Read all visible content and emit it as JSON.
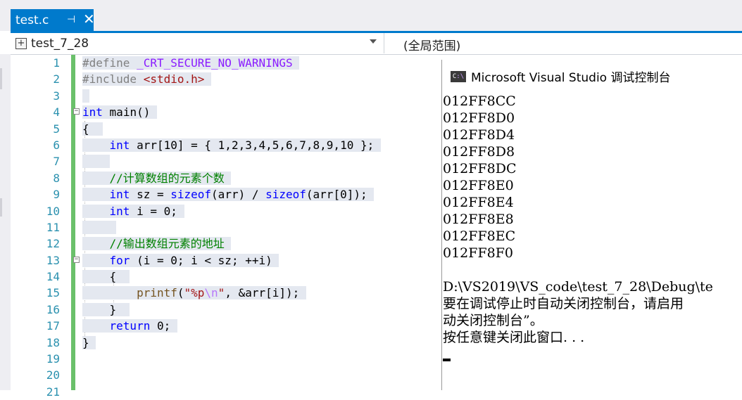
{
  "tab": {
    "title": "test.c",
    "pin_glyph": "⊣",
    "close_glyph": "✕"
  },
  "navbar": {
    "scope_left": "test_7_28",
    "scope_right": "(全局范围)"
  },
  "editor": {
    "line_numbers": [
      "1",
      "2",
      "3",
      "4",
      "5",
      "6",
      "7",
      "8",
      "9",
      "10",
      "11",
      "12",
      "13",
      "14",
      "15",
      "16",
      "17",
      "18",
      "19",
      "20",
      "21"
    ]
  },
  "console": {
    "title": "Microsoft Visual Studio 调试控制台",
    "output_lines": [
      "012FF8CC",
      "012FF8D0",
      "012FF8D4",
      "012FF8D8",
      "012FF8DC",
      "012FF8E0",
      "012FF8E4",
      "012FF8E8",
      "012FF8EC",
      "012FF8F0",
      "",
      "D:\\VS2019\\VS_code\\test_7_28\\Debug\\te",
      "要在调试停止时自动关闭控制台，请启用",
      "动关闭控制台”。",
      "按任意键关闭此窗口. . ."
    ]
  },
  "code": {
    "l1_kw": "#define",
    "l1_macro": "_CRT_SECURE_NO_WARNINGS",
    "l2_kw": "#include",
    "l2_hdr": "<stdio.h>",
    "l4_type": "int",
    "l4_rest": "main()",
    "l5": "{",
    "l6_type": "int",
    "l6_rest": "arr[10] = { 1,2,3,4,5,6,7,8,9,10 };",
    "l8_comment": "//计算数组的元素个数",
    "l9_type": "int",
    "l9_a": "sz = ",
    "l9_sizeof1": "sizeof",
    "l9_b": "(arr) / ",
    "l9_sizeof2": "sizeof",
    "l9_c": "(arr[0]);",
    "l10_type": "int",
    "l10_rest": "i = 0;",
    "l12_comment": "//输出数组元素的地址",
    "l13_kw": "for",
    "l13_rest": "(i = 0; i < sz; ++i)",
    "l14": "{",
    "l15_fn": "printf",
    "l15_open": "(",
    "l15_str1": "\"%p",
    "l15_esc": "\\n",
    "l15_str2": "\"",
    "l15_rest": ", &arr[i]);",
    "l16": "}",
    "l17_kw": "return",
    "l17_rest": "0;",
    "l18": "}"
  }
}
